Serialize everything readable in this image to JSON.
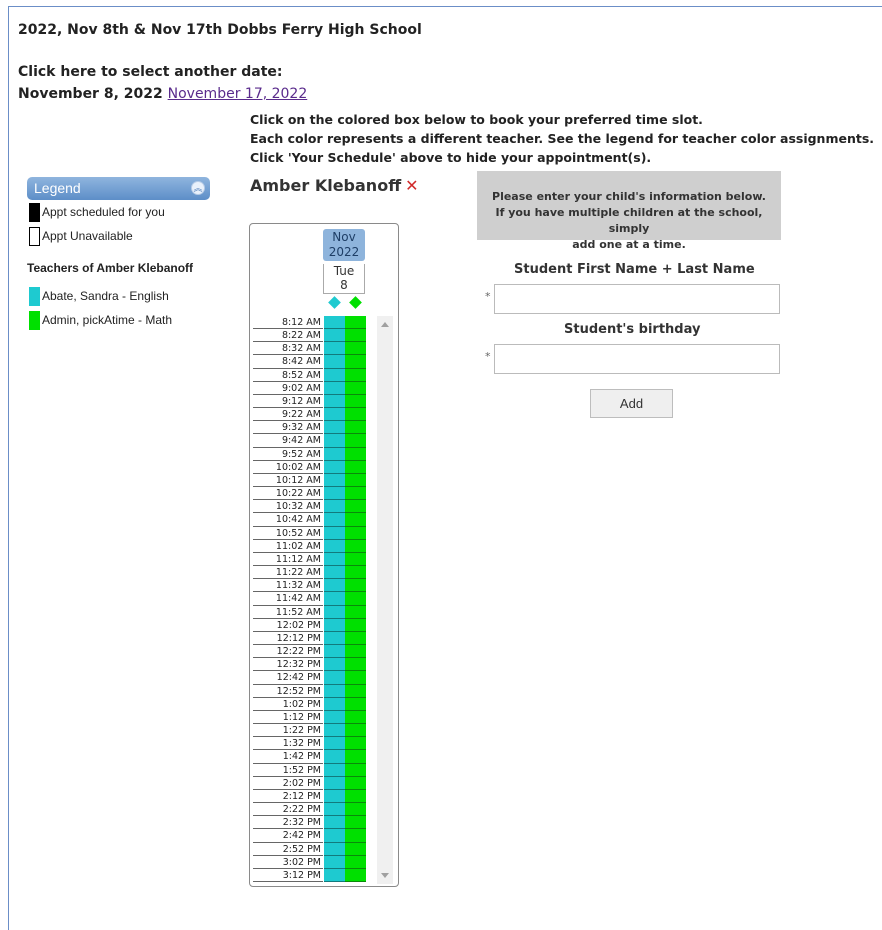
{
  "header": {
    "title": "2022, Nov 8th & Nov 17th Dobbs Ferry High School",
    "select_prompt": "Click here to select another date:",
    "current_date": "November 8, 2022",
    "other_date_link": "November 17, 2022"
  },
  "instructions": [
    "Click on the colored box below to book your preferred time slot.",
    "Each color represents a different teacher. See the legend for teacher color assignments.",
    "Click 'Your Schedule' above to hide your appointment(s)."
  ],
  "legend": {
    "title": "Legend",
    "items": [
      {
        "label": "Appt scheduled for you",
        "color": "#000000"
      },
      {
        "label": "Appt Unavailable",
        "color": "#ffffff"
      }
    ],
    "teachers_heading": "Teachers of Amber Klebanoff",
    "teachers": [
      {
        "label": "Abate, Sandra - English",
        "color": "#1ecad0"
      },
      {
        "label": "Admin, pickAtime - Math",
        "color": "#00e000"
      }
    ]
  },
  "student": {
    "name": "Amber Klebanoff"
  },
  "calendar": {
    "month": "Nov",
    "year": "2022",
    "weekday": "Tue",
    "day": "8",
    "times": [
      "8:12 AM",
      "8:22 AM",
      "8:32 AM",
      "8:42 AM",
      "8:52 AM",
      "9:02 AM",
      "9:12 AM",
      "9:22 AM",
      "9:32 AM",
      "9:42 AM",
      "9:52 AM",
      "10:02 AM",
      "10:12 AM",
      "10:22 AM",
      "10:32 AM",
      "10:42 AM",
      "10:52 AM",
      "11:02 AM",
      "11:12 AM",
      "11:22 AM",
      "11:32 AM",
      "11:42 AM",
      "11:52 AM",
      "12:02 PM",
      "12:12 PM",
      "12:22 PM",
      "12:32 PM",
      "12:42 PM",
      "12:52 PM",
      "1:02 PM",
      "1:12 PM",
      "1:22 PM",
      "1:32 PM",
      "1:42 PM",
      "1:52 PM",
      "2:02 PM",
      "2:12 PM",
      "2:22 PM",
      "2:32 PM",
      "2:42 PM",
      "2:52 PM",
      "3:02 PM",
      "3:12 PM"
    ]
  },
  "form": {
    "info_lines": [
      "Please enter your child's information below.",
      "If you have multiple children at the school, simply",
      "add one at a time."
    ],
    "name_label": "Student First Name + Last Name",
    "name_value": "",
    "birthday_label": "Student's birthday",
    "birthday_value": "",
    "required_marker": "*",
    "add_label": "Add"
  },
  "colors": {
    "teacher_a": "#1ecad0",
    "teacher_b": "#00e000",
    "legend_header": "#5d8ec8",
    "remove_icon": "#d12a2a"
  }
}
